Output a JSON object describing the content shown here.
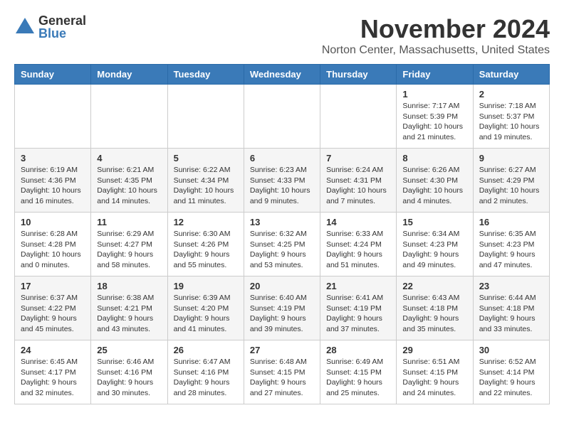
{
  "logo": {
    "general": "General",
    "blue": "Blue"
  },
  "header": {
    "month_year": "November 2024",
    "location": "Norton Center, Massachusetts, United States"
  },
  "weekdays": [
    "Sunday",
    "Monday",
    "Tuesday",
    "Wednesday",
    "Thursday",
    "Friday",
    "Saturday"
  ],
  "weeks": [
    [
      {
        "day": "",
        "info": ""
      },
      {
        "day": "",
        "info": ""
      },
      {
        "day": "",
        "info": ""
      },
      {
        "day": "",
        "info": ""
      },
      {
        "day": "",
        "info": ""
      },
      {
        "day": "1",
        "info": "Sunrise: 7:17 AM\nSunset: 5:39 PM\nDaylight: 10 hours and 21 minutes."
      },
      {
        "day": "2",
        "info": "Sunrise: 7:18 AM\nSunset: 5:37 PM\nDaylight: 10 hours and 19 minutes."
      }
    ],
    [
      {
        "day": "3",
        "info": "Sunrise: 6:19 AM\nSunset: 4:36 PM\nDaylight: 10 hours and 16 minutes."
      },
      {
        "day": "4",
        "info": "Sunrise: 6:21 AM\nSunset: 4:35 PM\nDaylight: 10 hours and 14 minutes."
      },
      {
        "day": "5",
        "info": "Sunrise: 6:22 AM\nSunset: 4:34 PM\nDaylight: 10 hours and 11 minutes."
      },
      {
        "day": "6",
        "info": "Sunrise: 6:23 AM\nSunset: 4:33 PM\nDaylight: 10 hours and 9 minutes."
      },
      {
        "day": "7",
        "info": "Sunrise: 6:24 AM\nSunset: 4:31 PM\nDaylight: 10 hours and 7 minutes."
      },
      {
        "day": "8",
        "info": "Sunrise: 6:26 AM\nSunset: 4:30 PM\nDaylight: 10 hours and 4 minutes."
      },
      {
        "day": "9",
        "info": "Sunrise: 6:27 AM\nSunset: 4:29 PM\nDaylight: 10 hours and 2 minutes."
      }
    ],
    [
      {
        "day": "10",
        "info": "Sunrise: 6:28 AM\nSunset: 4:28 PM\nDaylight: 10 hours and 0 minutes."
      },
      {
        "day": "11",
        "info": "Sunrise: 6:29 AM\nSunset: 4:27 PM\nDaylight: 9 hours and 58 minutes."
      },
      {
        "day": "12",
        "info": "Sunrise: 6:30 AM\nSunset: 4:26 PM\nDaylight: 9 hours and 55 minutes."
      },
      {
        "day": "13",
        "info": "Sunrise: 6:32 AM\nSunset: 4:25 PM\nDaylight: 9 hours and 53 minutes."
      },
      {
        "day": "14",
        "info": "Sunrise: 6:33 AM\nSunset: 4:24 PM\nDaylight: 9 hours and 51 minutes."
      },
      {
        "day": "15",
        "info": "Sunrise: 6:34 AM\nSunset: 4:23 PM\nDaylight: 9 hours and 49 minutes."
      },
      {
        "day": "16",
        "info": "Sunrise: 6:35 AM\nSunset: 4:23 PM\nDaylight: 9 hours and 47 minutes."
      }
    ],
    [
      {
        "day": "17",
        "info": "Sunrise: 6:37 AM\nSunset: 4:22 PM\nDaylight: 9 hours and 45 minutes."
      },
      {
        "day": "18",
        "info": "Sunrise: 6:38 AM\nSunset: 4:21 PM\nDaylight: 9 hours and 43 minutes."
      },
      {
        "day": "19",
        "info": "Sunrise: 6:39 AM\nSunset: 4:20 PM\nDaylight: 9 hours and 41 minutes."
      },
      {
        "day": "20",
        "info": "Sunrise: 6:40 AM\nSunset: 4:19 PM\nDaylight: 9 hours and 39 minutes."
      },
      {
        "day": "21",
        "info": "Sunrise: 6:41 AM\nSunset: 4:19 PM\nDaylight: 9 hours and 37 minutes."
      },
      {
        "day": "22",
        "info": "Sunrise: 6:43 AM\nSunset: 4:18 PM\nDaylight: 9 hours and 35 minutes."
      },
      {
        "day": "23",
        "info": "Sunrise: 6:44 AM\nSunset: 4:18 PM\nDaylight: 9 hours and 33 minutes."
      }
    ],
    [
      {
        "day": "24",
        "info": "Sunrise: 6:45 AM\nSunset: 4:17 PM\nDaylight: 9 hours and 32 minutes."
      },
      {
        "day": "25",
        "info": "Sunrise: 6:46 AM\nSunset: 4:16 PM\nDaylight: 9 hours and 30 minutes."
      },
      {
        "day": "26",
        "info": "Sunrise: 6:47 AM\nSunset: 4:16 PM\nDaylight: 9 hours and 28 minutes."
      },
      {
        "day": "27",
        "info": "Sunrise: 6:48 AM\nSunset: 4:15 PM\nDaylight: 9 hours and 27 minutes."
      },
      {
        "day": "28",
        "info": "Sunrise: 6:49 AM\nSunset: 4:15 PM\nDaylight: 9 hours and 25 minutes."
      },
      {
        "day": "29",
        "info": "Sunrise: 6:51 AM\nSunset: 4:15 PM\nDaylight: 9 hours and 24 minutes."
      },
      {
        "day": "30",
        "info": "Sunrise: 6:52 AM\nSunset: 4:14 PM\nDaylight: 9 hours and 22 minutes."
      }
    ]
  ]
}
